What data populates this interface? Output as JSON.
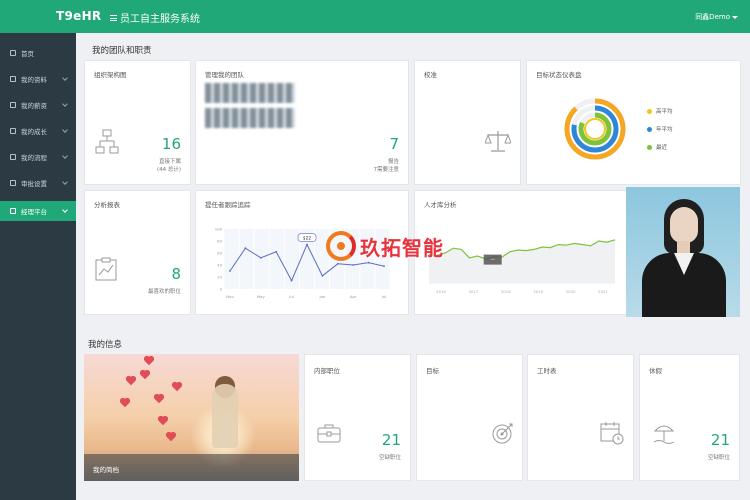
{
  "header": {
    "logo": "T9eHR",
    "title": "员工自主服务系统",
    "user": "同鑫Demo"
  },
  "sidebar": {
    "items": [
      {
        "label": "首页",
        "icon": "home-icon"
      },
      {
        "label": "我的资料",
        "icon": "profile-icon"
      },
      {
        "label": "我的薪资",
        "icon": "salary-icon"
      },
      {
        "label": "我的成长",
        "icon": "growth-icon"
      },
      {
        "label": "我的流程",
        "icon": "workflow-icon"
      },
      {
        "label": "审批设置",
        "icon": "approval-icon"
      },
      {
        "label": "经理平台",
        "icon": "manager-icon",
        "active": true
      }
    ]
  },
  "team_section": {
    "title": "我的团队和职责",
    "org": {
      "title": "组织架构图",
      "value": "16",
      "label": "直接下属",
      "sub": "(44 总计)",
      "icon": "org-chart-icon"
    },
    "managed_team": {
      "title": "管理我的团队",
      "value": "7",
      "label": "报告",
      "sub": "7需要注意",
      "icon": "person-icon"
    },
    "calibration": {
      "title": "校准",
      "icon": "balance-scale-icon"
    },
    "goal_dashboard": {
      "title": "目标状态仪表盘",
      "legend": [
        "高平均",
        "年平均",
        "最近"
      ],
      "colors": {
        "high": "#f5c518",
        "year": "#2f86d6",
        "recent": "#7dc23a",
        "orange": "#f5a623"
      },
      "ring_levels": {
        "outer": 0.88,
        "middle": 0.78,
        "inner": 0.82
      }
    },
    "analytics": {
      "title": "分析报表",
      "value": "8",
      "label": "最喜欢的职位",
      "icon": "report-icon"
    },
    "recruit_tracking": {
      "title": "提任者跟踪追踪",
      "tooltip": "$22",
      "x_labels": [
        "Nov",
        "May",
        "Jul",
        "Jan",
        "Apr",
        "Jul"
      ],
      "y_labels": [
        "100",
        "80",
        "60",
        "40",
        "20",
        "0"
      ],
      "values": [
        30,
        68,
        52,
        62,
        14,
        74,
        22,
        42,
        40,
        44,
        38
      ]
    },
    "talent_pool": {
      "title": "人才库分析",
      "tooltip": "—",
      "x_labels": [
        "2016",
        "2017",
        "2018",
        "2019",
        "2020",
        "2021"
      ],
      "values": [
        48,
        46,
        50,
        58,
        56,
        42,
        45,
        40,
        44,
        43,
        52,
        55,
        54,
        56,
        60,
        59,
        64,
        63,
        66,
        64,
        62,
        70,
        68,
        72
      ]
    }
  },
  "info_section": {
    "title": "我的信息",
    "hero_caption": "我的简档",
    "internal_jobs": {
      "title": "内部职位",
      "value": "21",
      "label": "空缺职位",
      "icon": "briefcase-icon"
    },
    "goals": {
      "title": "目标",
      "icon": "target-icon"
    },
    "timesheet": {
      "title": "工时表",
      "icon": "calendar-icon"
    },
    "vacation": {
      "title": "休假",
      "value": "21",
      "label": "空缺职位",
      "icon": "beach-icon"
    }
  },
  "watermark": {
    "text": "玖拓智能"
  }
}
